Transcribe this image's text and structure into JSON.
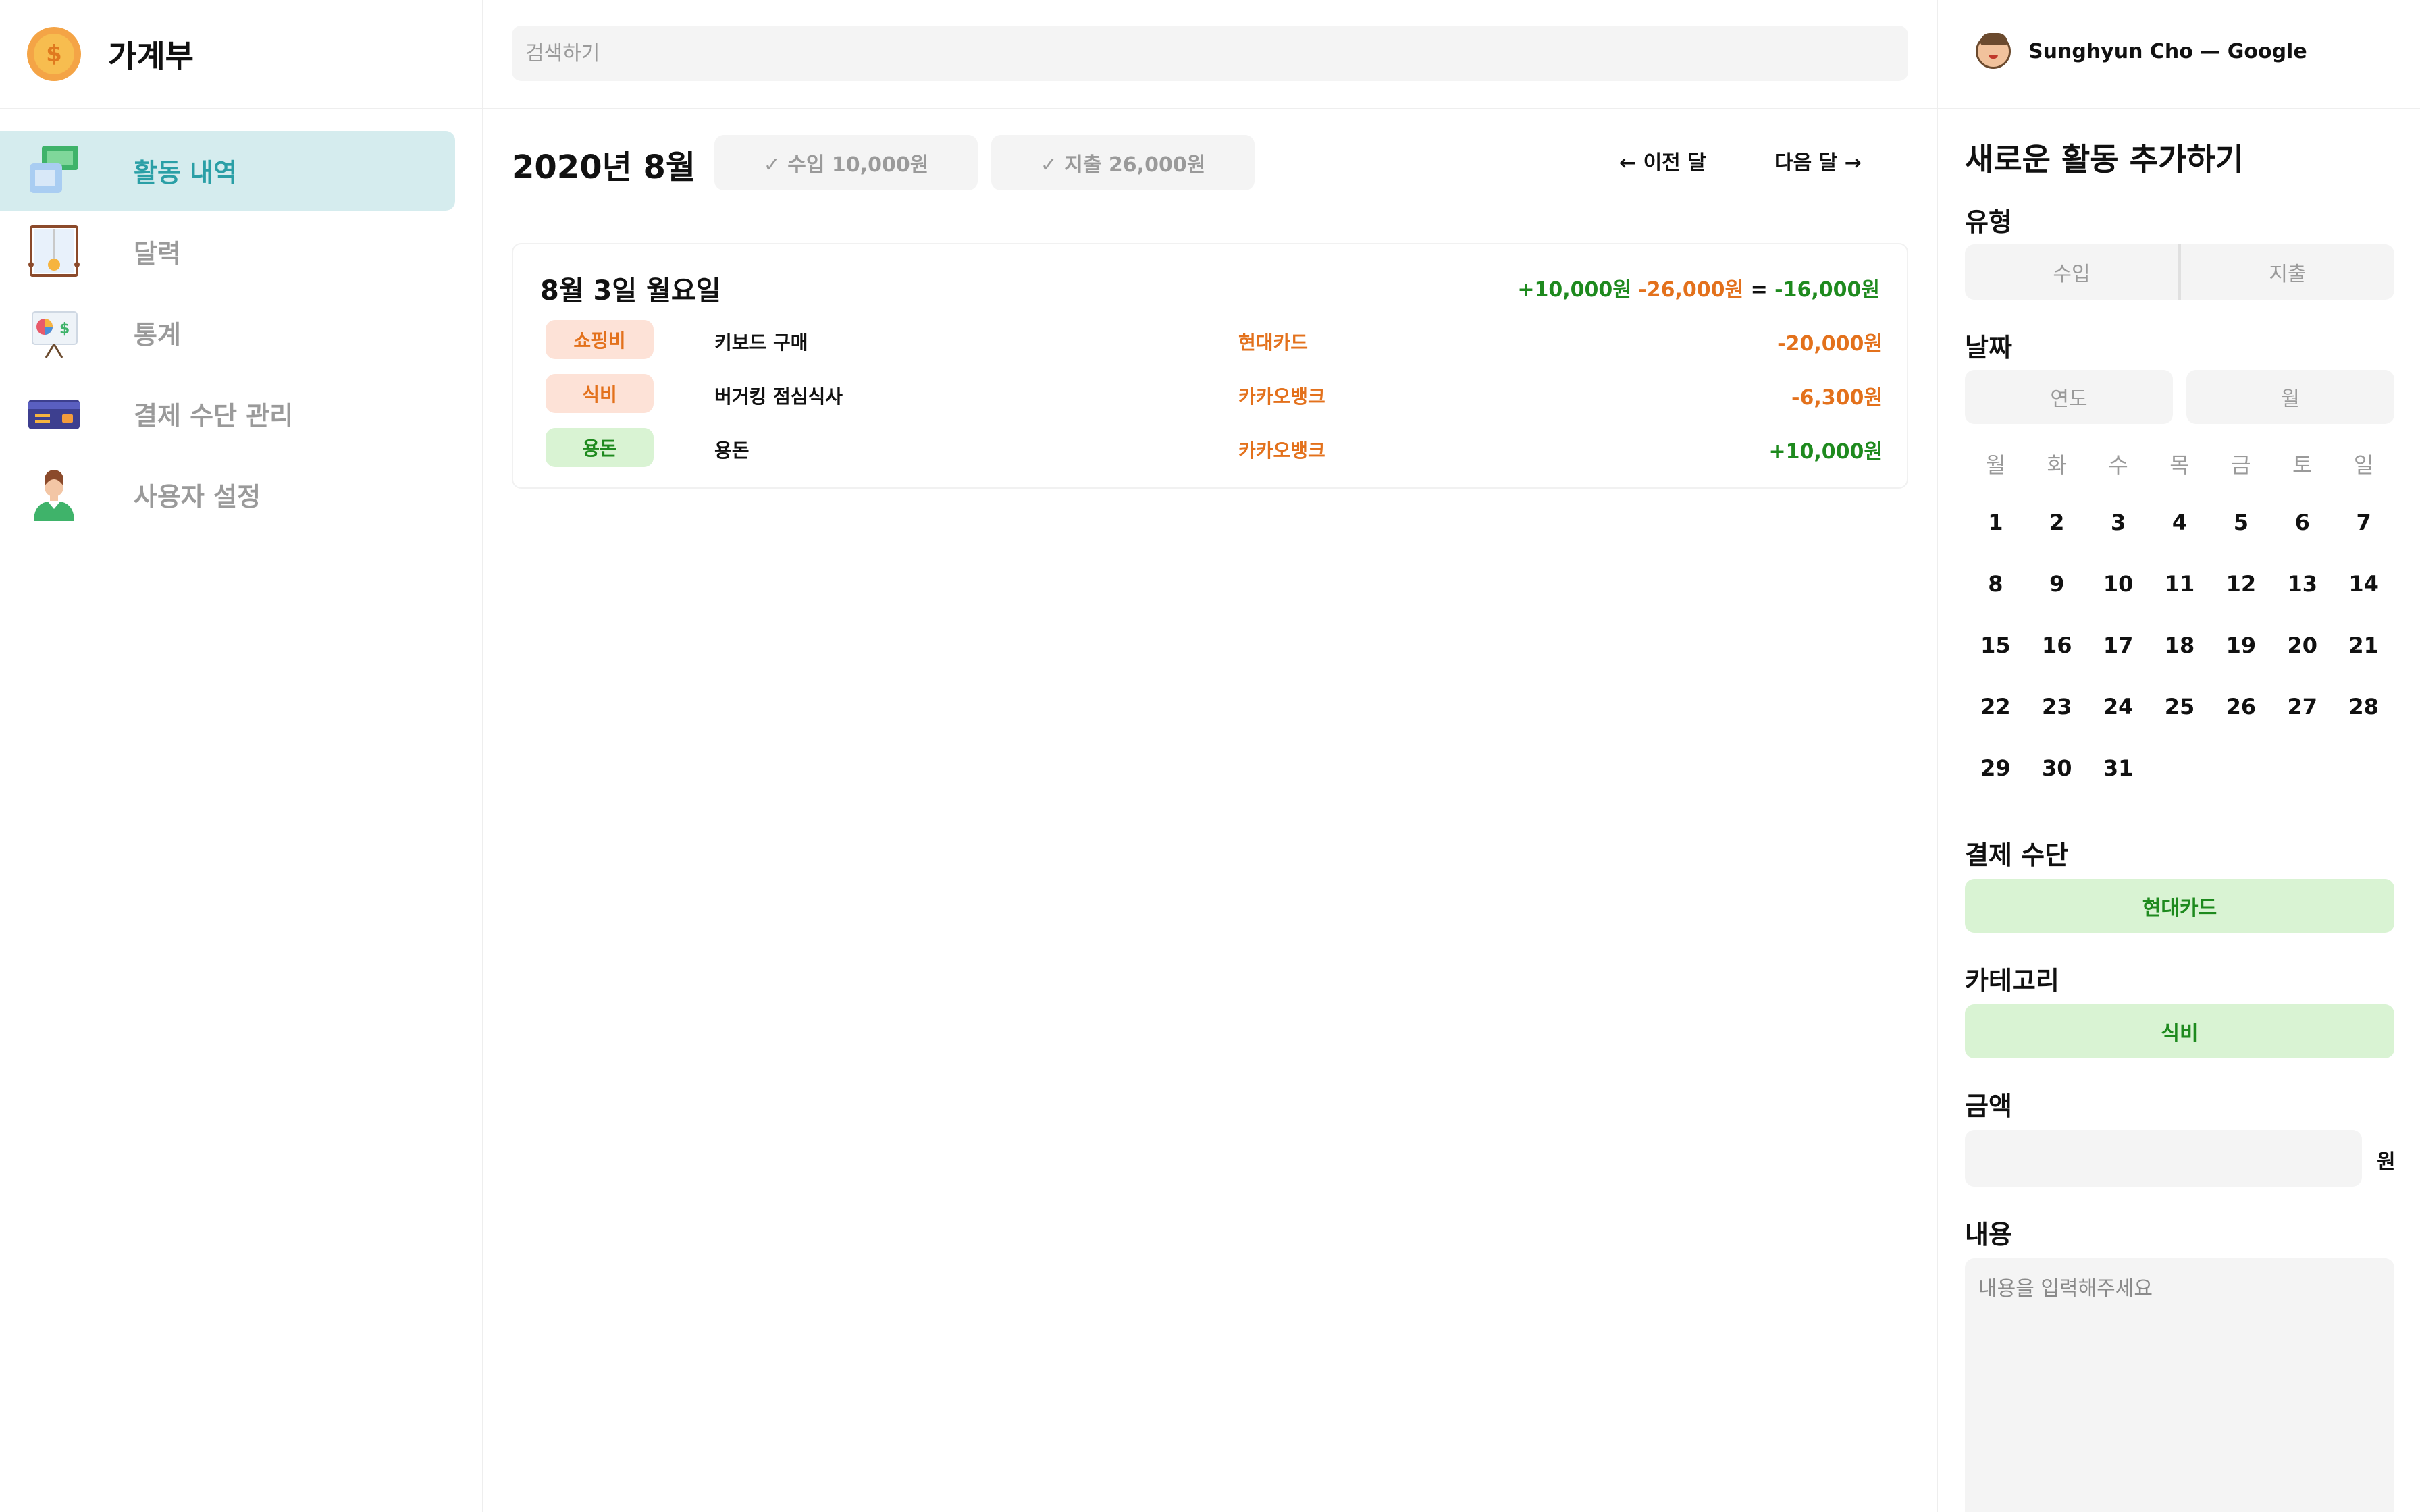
{
  "app": {
    "title": "가계부"
  },
  "sidebar": {
    "items": [
      {
        "label": "활동 내역",
        "icon": "money-icon",
        "active": true
      },
      {
        "label": "달력",
        "icon": "calendar-icon",
        "active": false
      },
      {
        "label": "통계",
        "icon": "chart-board-icon",
        "active": false
      },
      {
        "label": "결제 수단 관리",
        "icon": "credit-card-icon",
        "active": false
      },
      {
        "label": "사용자 설정",
        "icon": "user-icon",
        "active": false
      }
    ]
  },
  "search": {
    "placeholder": "검색하기"
  },
  "header": {
    "month_title": "2020년 8월",
    "income_filter": "✓ 수입 10,000원",
    "expense_filter": "✓ 지출 26,000원",
    "prev_label": "← 이전 달",
    "next_label": "다음 달 →"
  },
  "day_group": {
    "title": "8월 3일 월요일",
    "summary": {
      "income": "+10,000원",
      "expense": "-26,000원",
      "equals": " = ",
      "total": "-16,000원"
    },
    "rows": [
      {
        "category": "쇼핑비",
        "type": "expense",
        "description": "키보드 구매",
        "method": "현대카드",
        "amount": "-20,000원"
      },
      {
        "category": "식비",
        "type": "expense",
        "description": "버거킹 점심식사",
        "method": "카카오뱅크",
        "amount": "-6,300원"
      },
      {
        "category": "용돈",
        "type": "income",
        "description": "용돈",
        "method": "카카오뱅크",
        "amount": "+10,000원"
      }
    ]
  },
  "user": {
    "name": "Sunghyun Cho — Google"
  },
  "form": {
    "title": "새로운 활동 추가하기",
    "type_label": "유형",
    "type_options": [
      "수입",
      "지출"
    ],
    "date_label": "날짜",
    "year_placeholder": "연도",
    "month_placeholder": "월",
    "weekdays": [
      "월",
      "화",
      "수",
      "목",
      "금",
      "토",
      "일"
    ],
    "weeks": [
      [
        "1",
        "2",
        "3",
        "4",
        "5",
        "6",
        "7"
      ],
      [
        "8",
        "9",
        "10",
        "11",
        "12",
        "13",
        "14"
      ],
      [
        "15",
        "16",
        "17",
        "18",
        "19",
        "20",
        "21"
      ],
      [
        "22",
        "23",
        "24",
        "25",
        "26",
        "27",
        "28"
      ],
      [
        "29",
        "30",
        "31",
        "",
        "",
        "",
        ""
      ]
    ],
    "payment_label": "결제 수단",
    "payment_value": "현대카드",
    "category_label": "카테고리",
    "category_value": "식비",
    "amount_label": "금액",
    "amount_unit": "원",
    "memo_label": "내용",
    "memo_placeholder": "내용을 입력해주세요"
  },
  "colors": {
    "accent": "#2a9fa6",
    "income": "#1e8a1e",
    "expense": "#e3711c",
    "active_bg": "#d5ecee"
  }
}
